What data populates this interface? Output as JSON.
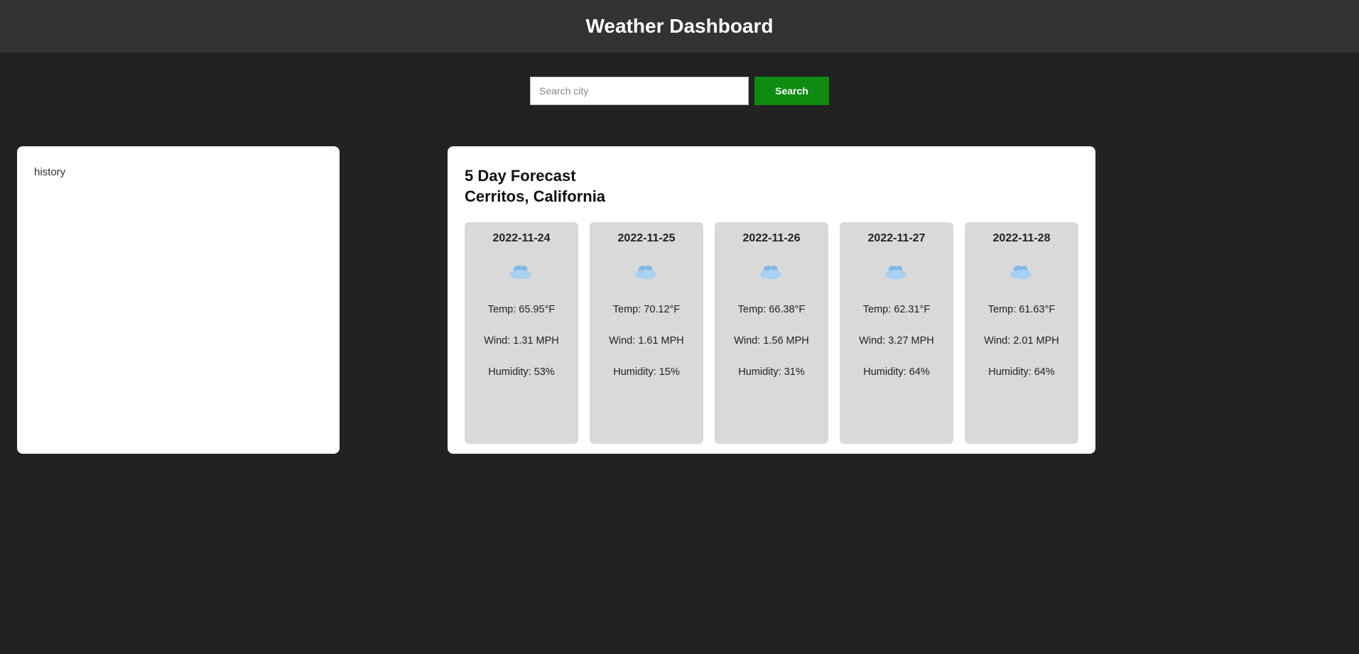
{
  "header": {
    "title": "Weather Dashboard"
  },
  "search": {
    "placeholder": "Search city",
    "value": "",
    "button_label": "Search"
  },
  "history": {
    "title": "history"
  },
  "forecast": {
    "heading": "5 Day Forecast",
    "location": "Cerritos, California",
    "days": [
      {
        "date": "2022-11-24",
        "icon": "cloud",
        "temp": "Temp: 65.95°F",
        "wind": "Wind: 1.31 MPH",
        "humidity": "Humidity: 53%"
      },
      {
        "date": "2022-11-25",
        "icon": "cloud",
        "temp": "Temp: 70.12°F",
        "wind": "Wind: 1.61 MPH",
        "humidity": "Humidity: 15%"
      },
      {
        "date": "2022-11-26",
        "icon": "cloud",
        "temp": "Temp: 66.38°F",
        "wind": "Wind: 1.56 MPH",
        "humidity": "Humidity: 31%"
      },
      {
        "date": "2022-11-27",
        "icon": "cloud",
        "temp": "Temp: 62.31°F",
        "wind": "Wind: 3.27 MPH",
        "humidity": "Humidity: 64%"
      },
      {
        "date": "2022-11-28",
        "icon": "cloud",
        "temp": "Temp: 61.63°F",
        "wind": "Wind: 2.01 MPH",
        "humidity": "Humidity: 64%"
      }
    ]
  }
}
